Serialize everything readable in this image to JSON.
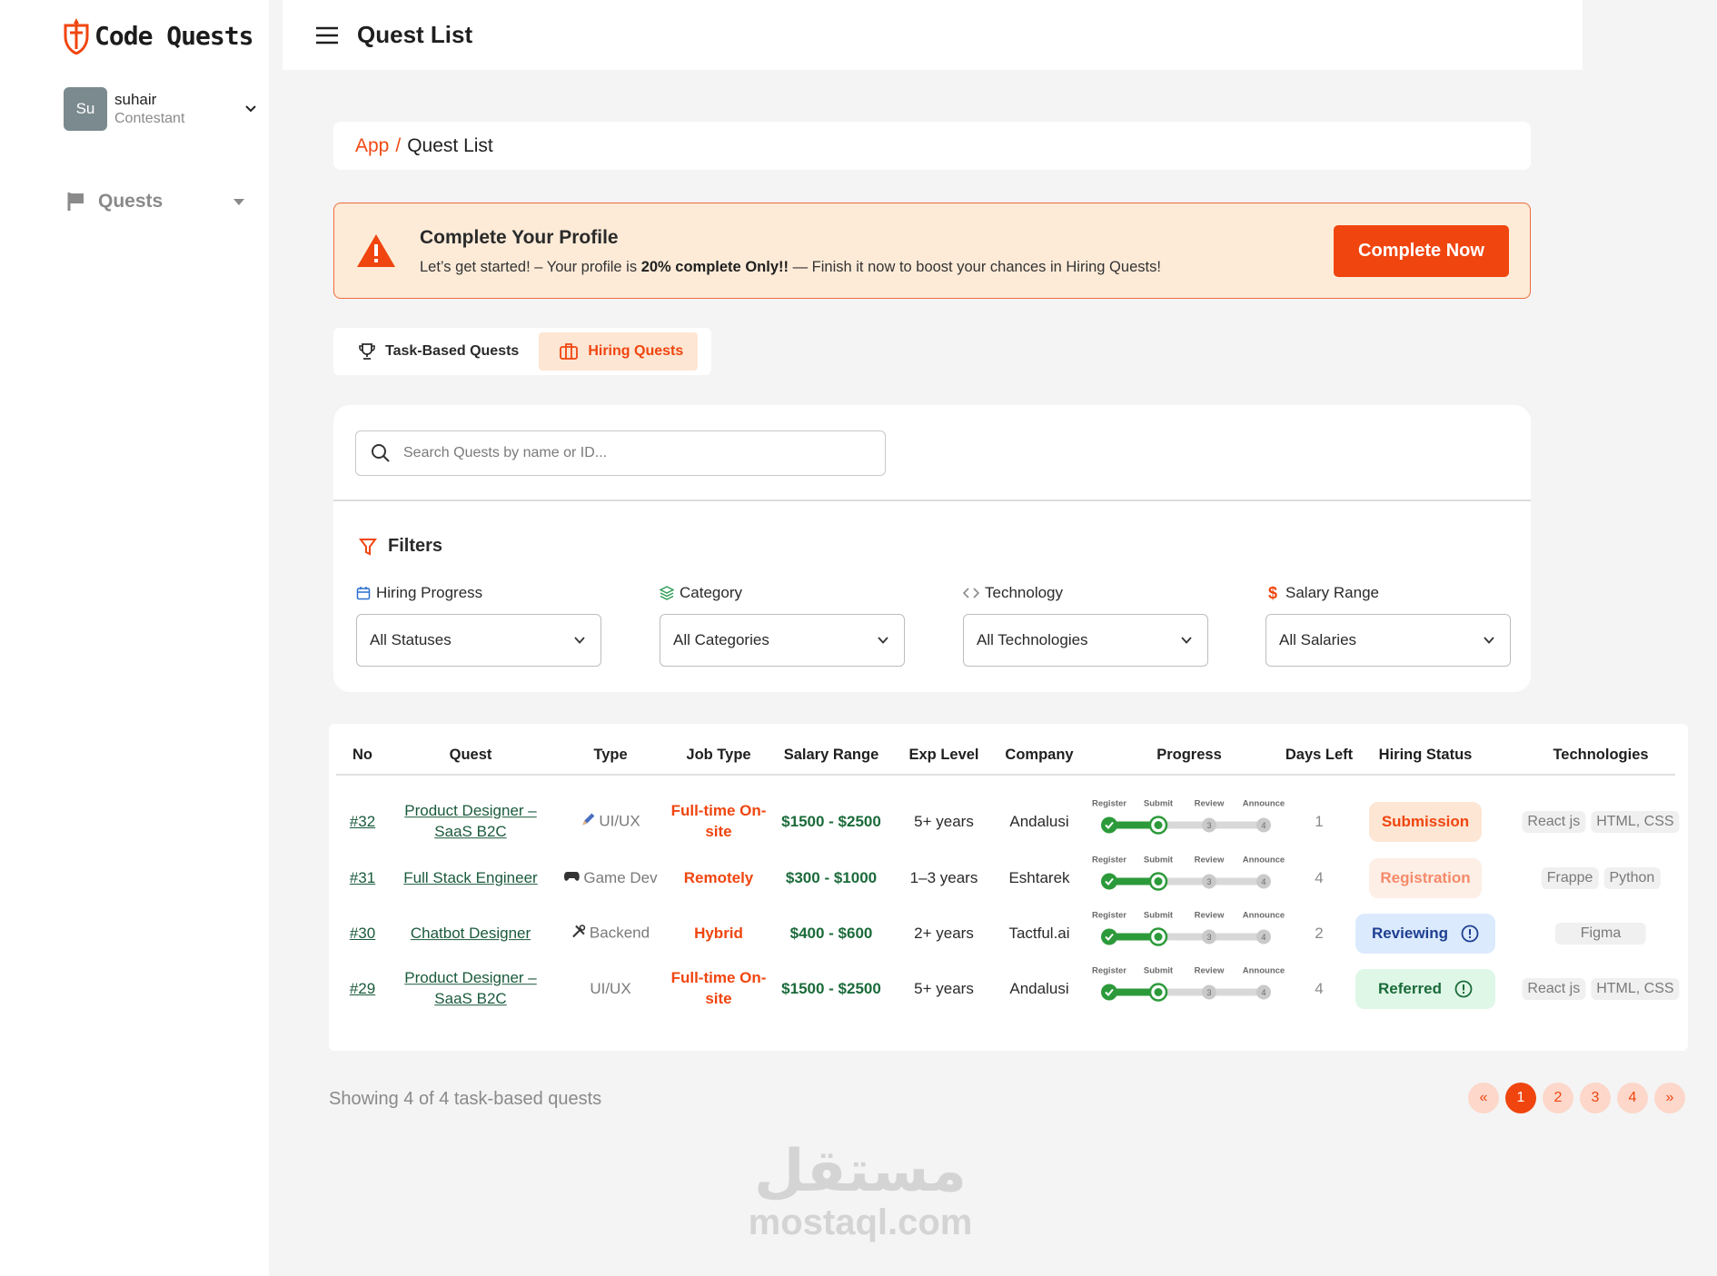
{
  "brand": {
    "name": "Code Quests",
    "accent": "#f0450f",
    "green": "#1b6b3a"
  },
  "user": {
    "initials": "Su",
    "name": "suhair",
    "role": "Contestant"
  },
  "sidebar": {
    "quests_label": "Quests"
  },
  "header": {
    "title": "Quest List"
  },
  "breadcrumb": {
    "app": "App",
    "sep": "/",
    "current": "Quest List"
  },
  "alert": {
    "title": "Complete Your Profile",
    "desc_pre": "Let’s get started! – Your profile is ",
    "desc_bold": "20% complete Only!!",
    "desc_post": " — Finish it now to boost your chances in Hiring Quests!",
    "button": "Complete Now"
  },
  "tabs": [
    {
      "label": "Task-Based Quests",
      "icon": "trophy-icon",
      "active": false
    },
    {
      "label": "Hiring Quests",
      "icon": "briefcase-icon",
      "active": true
    }
  ],
  "search": {
    "placeholder": "Search Quests by name or ID..."
  },
  "filters": {
    "title": "Filters",
    "groups": [
      {
        "label": "Hiring Progress",
        "icon": "calendar-icon",
        "value": "All Statuses"
      },
      {
        "label": "Category",
        "icon": "layers-icon",
        "value": "All Categories"
      },
      {
        "label": "Technology",
        "icon": "code-icon",
        "value": "All Technologies"
      },
      {
        "label": "Salary Range",
        "icon": "dollar-icon",
        "value": "All Salaries"
      }
    ]
  },
  "table": {
    "headers": [
      "No",
      "Quest",
      "Type",
      "Job Type",
      "Salary Range",
      "Exp Level",
      "Company",
      "Progress",
      "Days Left",
      "Hiring Status",
      "Technologies"
    ],
    "progress_steps": [
      "Register",
      "Submit",
      "Review",
      "Announce"
    ],
    "rows": [
      {
        "no": "#32",
        "quest": "Product Designer – SaaS B2C",
        "type": "UI/UX",
        "type_icon": "pencil-icon",
        "job_type": "Full-time On-site",
        "salary": "$1500 - $2500",
        "exp": "5+ years",
        "company": "Andalusi",
        "progress_completed": 2,
        "days_left": "1",
        "status": "Submission",
        "status_color": "#f0450f",
        "status_bg": "#fde6d4",
        "status_info": false,
        "technologies": [
          "React js",
          "HTML, CSS"
        ]
      },
      {
        "no": "#31",
        "quest": "Full Stack Engineer",
        "type": "Game Dev",
        "type_icon": "gamepad-icon",
        "job_type": "Remotely",
        "salary": "$300 - $1000",
        "exp": "1–3 years",
        "company": "Eshtarek",
        "progress_completed": 2,
        "days_left": "4",
        "status": "Registration",
        "status_color": "#f58a6a",
        "status_bg": "#fdeee6",
        "status_info": false,
        "technologies": [
          "Frappe",
          "Python"
        ]
      },
      {
        "no": "#30",
        "quest": "Chatbot Designer",
        "type": "Backend",
        "type_icon": "tools-icon",
        "job_type": "Hybrid",
        "salary": "$400 - $600",
        "exp": "2+ years",
        "company": "Tactful.ai",
        "progress_completed": 2,
        "days_left": "2",
        "status": "Reviewing",
        "status_color": "#1e3f91",
        "status_bg": "#dbeafd",
        "status_info": true,
        "technologies": [
          "Figma"
        ]
      },
      {
        "no": "#29",
        "quest": "Product Designer – SaaS B2C",
        "type": "UI/UX",
        "type_icon": "",
        "job_type": "Full-time On-site",
        "salary": "$1500 - $2500",
        "exp": "5+ years",
        "company": "Andalusi",
        "progress_completed": 2,
        "days_left": "4",
        "status": "Referred",
        "status_color": "#1b6b3a",
        "status_bg": "#dff7e7",
        "status_info": true,
        "technologies": [
          "React js",
          "HTML, CSS"
        ]
      }
    ]
  },
  "footer": {
    "showing": "Showing 4 of 4 task-based quests",
    "pages": [
      "«",
      "1",
      "2",
      "3",
      "4",
      "»"
    ],
    "current_page": "1"
  },
  "watermark": {
    "arabic": "مستقل",
    "latin": "mostaql.com"
  }
}
